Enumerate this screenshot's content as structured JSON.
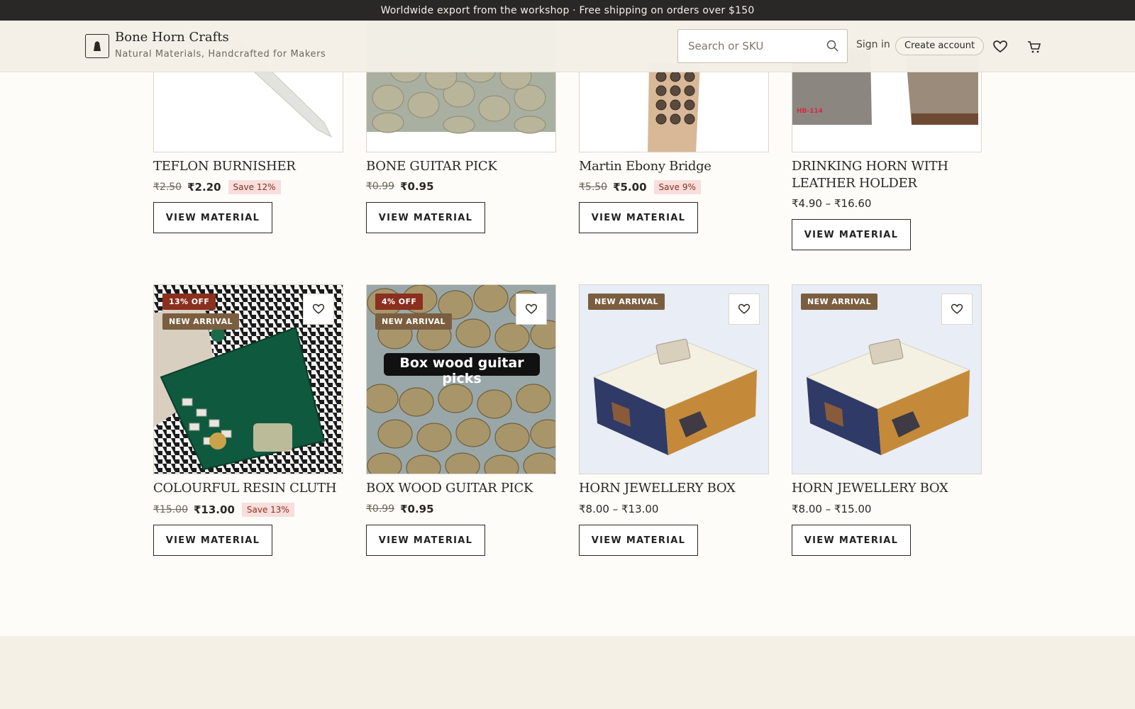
{
  "announcement": "Worldwide export from the workshop · Free shipping on orders over $150",
  "header": {
    "brand_name": "Bone Horn Crafts",
    "brand_tagline": "Natural Materials, Handcrafted for Makers",
    "search_placeholder": "Search or SKU",
    "sign_in": "Sign in",
    "create_account": "Create account",
    "icons": [
      "search-icon",
      "heart-icon",
      "cart-icon"
    ]
  },
  "products_row1": [
    {
      "title": "TEFLON BURNISHER",
      "old_price": "₹2.50",
      "price": "₹2.20",
      "save": "Save 12%",
      "button": "VIEW MATERIAL"
    },
    {
      "title": "BONE GUITAR PICK",
      "old_price": "₹0.99",
      "price": "₹0.95",
      "button": "VIEW MATERIAL"
    },
    {
      "title": "Martin Ebony Bridge",
      "old_price": "₹5.50",
      "price": "₹5.00",
      "save": "Save 9%",
      "button": "VIEW MATERIAL"
    },
    {
      "title": "DRINKING HORN WITH LEATHER HOLDER",
      "range": "₹4.90 – ₹16.60",
      "image_label": "HB-114",
      "button": "VIEW MATERIAL"
    }
  ],
  "products_row2": [
    {
      "title": "COLOURFUL RESIN CLUTH",
      "old_price": "₹15.00",
      "price": "₹13.00",
      "save": "Save 13%",
      "badge_off": "13% OFF",
      "badge_new": "NEW ARRIVAL",
      "button": "VIEW MATERIAL"
    },
    {
      "title": "BOX WOOD GUITAR PICK",
      "old_price": "₹0.99",
      "price": "₹0.95",
      "badge_off": "4% OFF",
      "badge_new": "NEW ARRIVAL",
      "image_caption": "Box wood guitar picks",
      "button": "VIEW MATERIAL"
    },
    {
      "title": "HORN JEWELLERY BOX",
      "range": "₹8.00 – ₹13.00",
      "badge_new": "NEW ARRIVAL",
      "button": "VIEW MATERIAL"
    },
    {
      "title": "HORN JEWELLERY BOX",
      "range": "₹8.00 – ₹15.00",
      "badge_new": "NEW ARRIVAL",
      "button": "VIEW MATERIAL"
    }
  ],
  "colors": {
    "announcement_bg": "#2a2826",
    "header_bg": "#f4f0e7",
    "badge_off": "#8b2f1e",
    "badge_new": "#7a5e3f",
    "save_bg": "#f7dedc",
    "page_bg": "#fdfcf8"
  }
}
